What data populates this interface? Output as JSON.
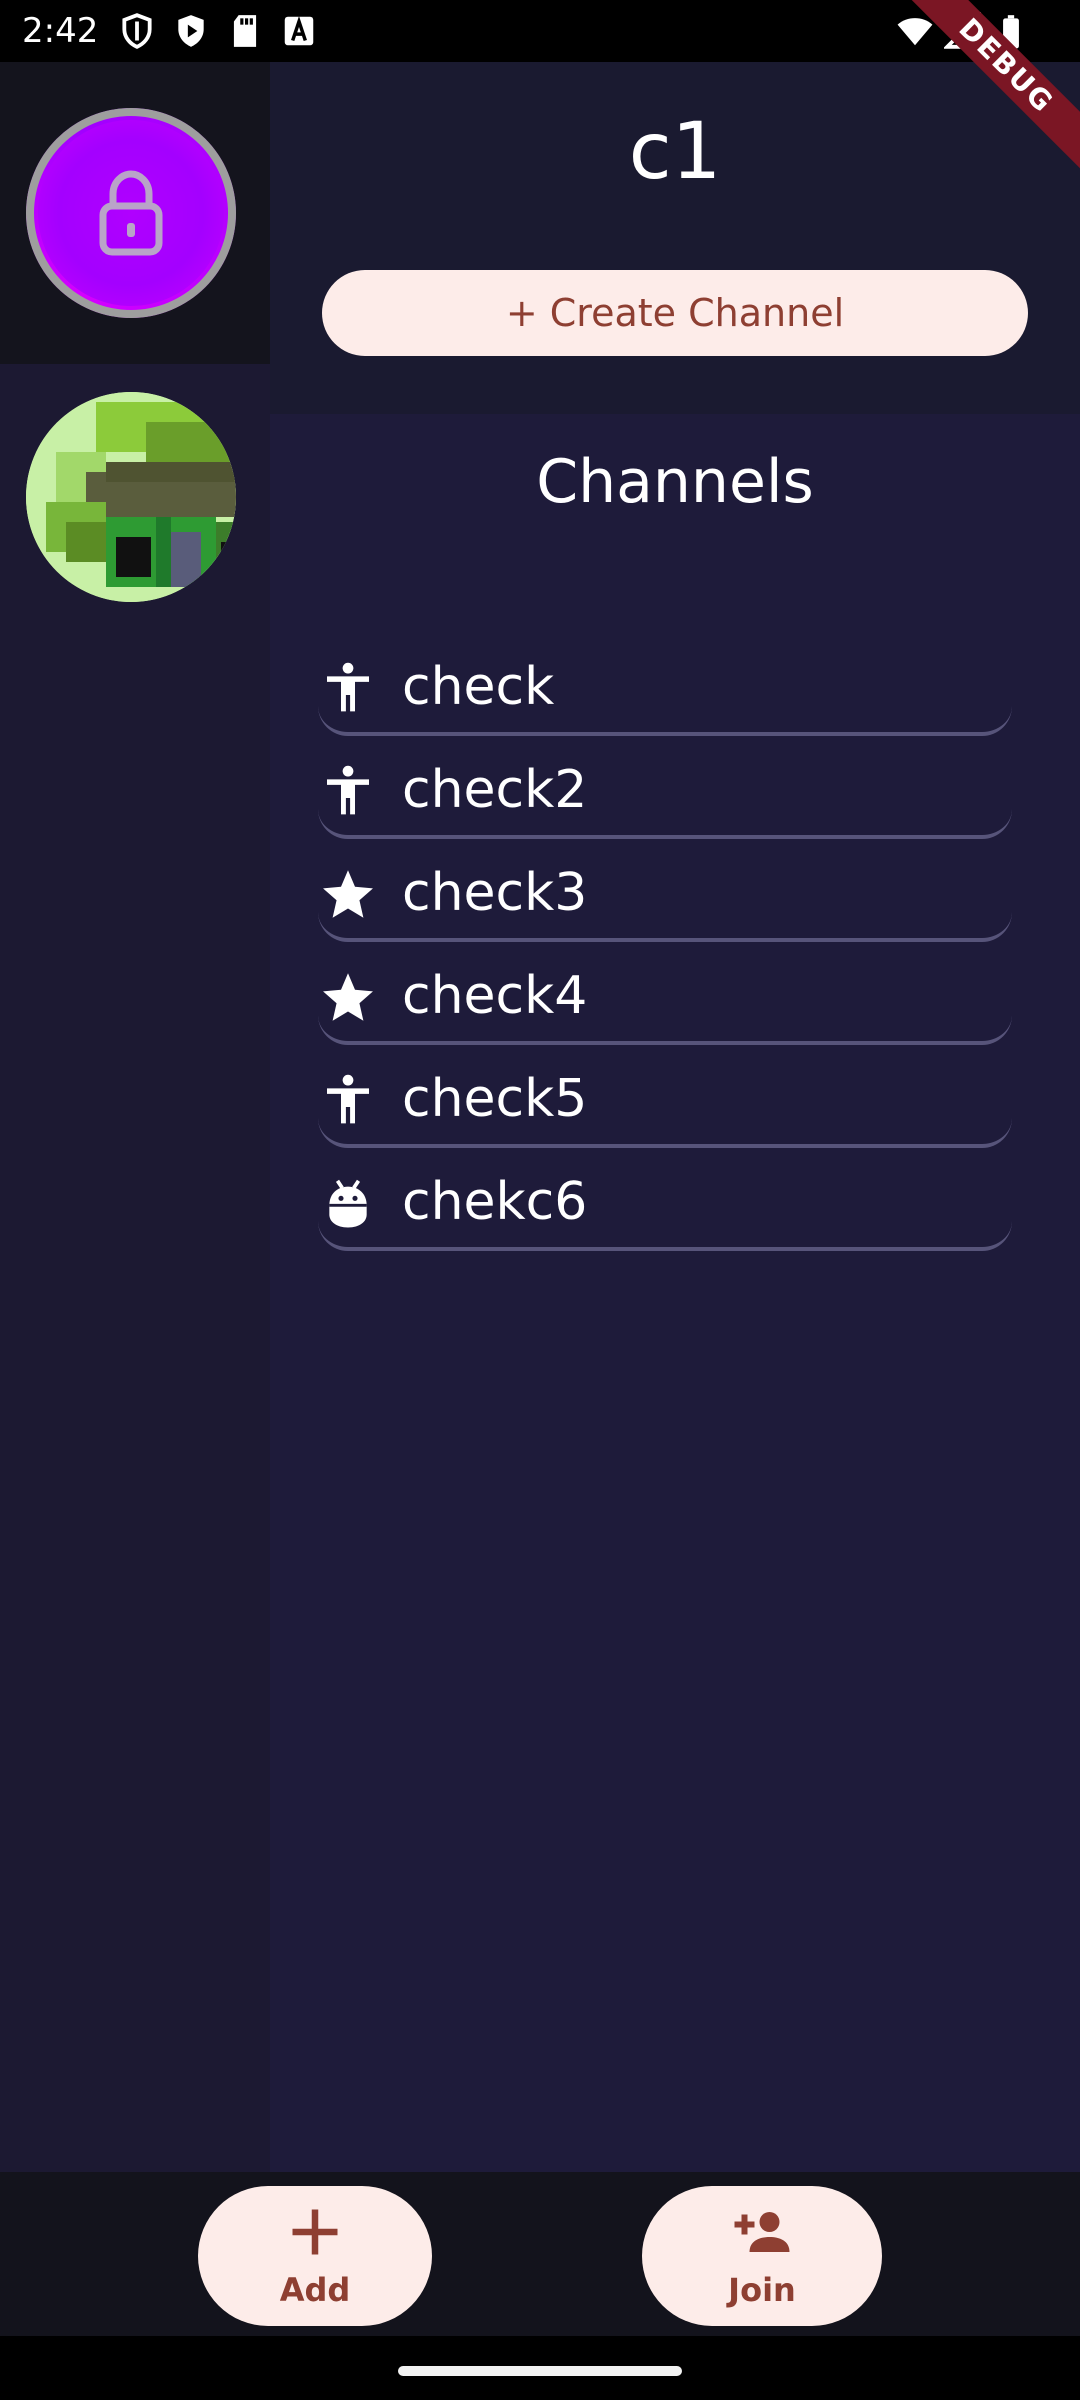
{
  "status_bar": {
    "time": "2:42",
    "left_icons": [
      "shield-icon",
      "play-icon",
      "sd-card-icon",
      "font-a-icon"
    ],
    "right_icons": [
      "wifi-icon",
      "signal-icon",
      "battery-icon"
    ]
  },
  "debug_banner": "DEBUG",
  "servers": [
    {
      "name": "locked-server",
      "icon": "lock-icon",
      "selected": true,
      "color": "#b300ff"
    },
    {
      "name": "pixel-server",
      "icon": "pixel-art-image",
      "selected": false
    }
  ],
  "header": {
    "server_name": "c1",
    "create_channel_label": "+ Create Channel"
  },
  "channels_heading": "Channels",
  "channels": [
    {
      "label": "check",
      "icon": "accessibility-icon"
    },
    {
      "label": "check2",
      "icon": "accessibility-icon"
    },
    {
      "label": "check3",
      "icon": "star-icon"
    },
    {
      "label": "check4",
      "icon": "star-icon"
    },
    {
      "label": "check5",
      "icon": "accessibility-icon"
    },
    {
      "label": "chekc6",
      "icon": "android-icon"
    }
  ],
  "bottom_bar": {
    "add_label": "Add",
    "join_label": "Join"
  },
  "colors": {
    "accent_button_bg": "#fdece9",
    "accent_button_text": "#8e3f32",
    "main_bg": "#1e1b3a",
    "rail_bg": "#1c1932",
    "debug_ribbon": "#7b1624"
  }
}
